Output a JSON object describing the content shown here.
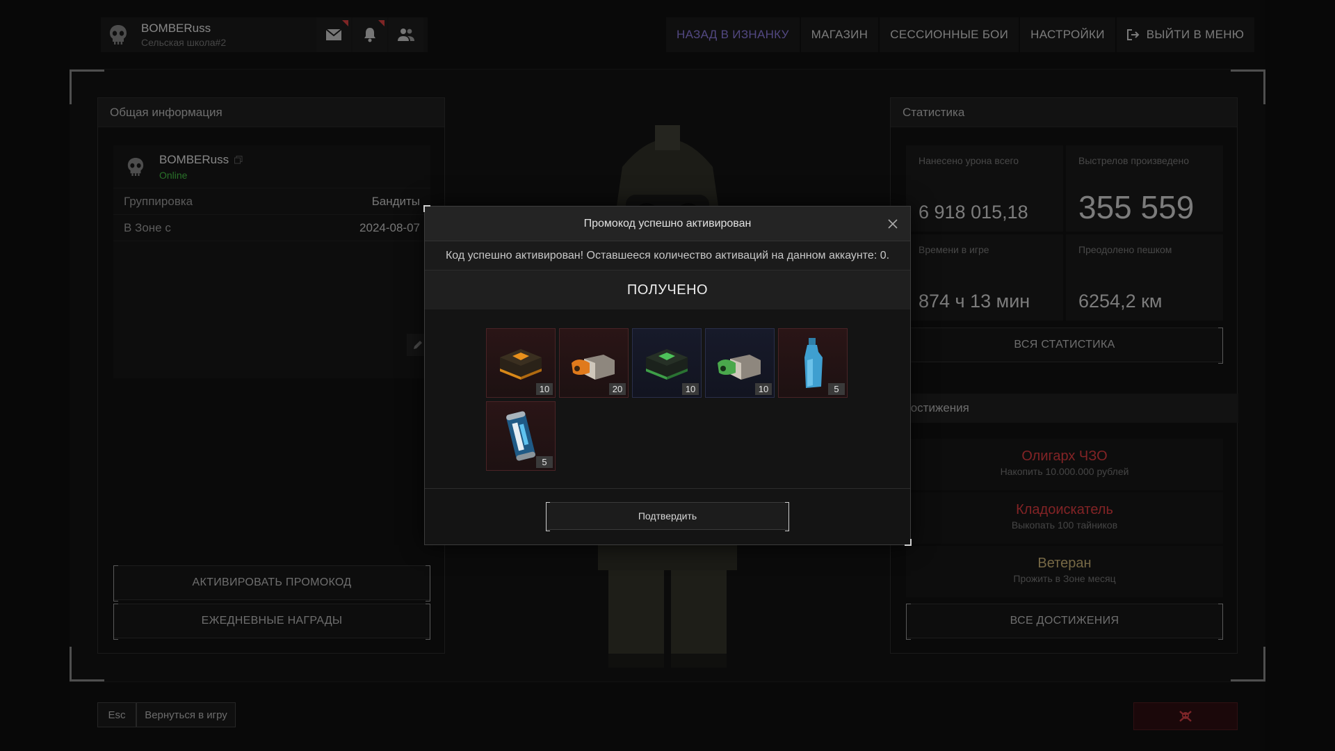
{
  "profile": {
    "name": "BOMBERuss",
    "school": "Сельская школа#2"
  },
  "nav": {
    "items": [
      "НАЗАД В ИЗНАНКУ",
      "МАГАЗИН",
      "СЕССИОННЫЕ БОИ",
      "НАСТРОЙКИ"
    ],
    "exit": "ВЫЙТИ В МЕНЮ"
  },
  "general": {
    "title": "Общая информация",
    "username": "BOMBERuss",
    "status": "Online",
    "rows": [
      {
        "label": "Группировка",
        "value": "Бандиты"
      },
      {
        "label": "В Зоне с",
        "value": "2024-08-07"
      }
    ],
    "promo_button": "АКТИВИРОВАТЬ ПРОМОКОД",
    "daily_button": "ЕЖЕДНЕВНЫЕ НАГРАДЫ"
  },
  "stats": {
    "title": "Статистика",
    "cells": [
      {
        "label": "Нанесено урона всего",
        "value": "6 918 015,18"
      },
      {
        "label": "Выстрелов произведено",
        "value": "355 559"
      },
      {
        "label": "Времени в игре",
        "value": "874 ч 13 мин"
      },
      {
        "label": "Преодолено пешком",
        "value": "6254,2 км"
      }
    ],
    "all_button": "ВСЯ СТАТИСТИКА"
  },
  "achievements": {
    "title": "Достижения",
    "items": [
      {
        "title": "Олигарх ЧЗО",
        "desc": "Накопить 10.000.000 рублей",
        "color": "#c8363a"
      },
      {
        "title": "Кладоискатель",
        "desc": "Выкопать 100 тайников",
        "color": "#c8363a"
      },
      {
        "title": "Ветеран",
        "desc": "Прожить в Зоне месяц",
        "color": "#b5a06a"
      }
    ],
    "all_button": "ВСЕ ДОСТИЖЕНИЯ"
  },
  "bottom": {
    "esc": "Esc",
    "back": "Вернуться в игру"
  },
  "modal": {
    "title": "Промокод успешно активирован",
    "message": "Код успешно активирован! Оставшееся количество активаций на данном аккаунте: 0.",
    "received": "ПОЛУЧЕНО",
    "items": [
      {
        "icon": "orange-ammo-box-icon",
        "count": "10",
        "rarity": "red"
      },
      {
        "icon": "orange-open-crate-icon",
        "count": "20",
        "rarity": "red"
      },
      {
        "icon": "green-ammo-box-icon",
        "count": "10",
        "rarity": "blue"
      },
      {
        "icon": "green-open-crate-icon",
        "count": "10",
        "rarity": "blue"
      },
      {
        "icon": "blue-bottle-icon",
        "count": "5",
        "rarity": "red"
      },
      {
        "icon": "energy-drink-can-icon",
        "count": "5",
        "rarity": "red"
      }
    ],
    "confirm": "Подтвердить"
  }
}
